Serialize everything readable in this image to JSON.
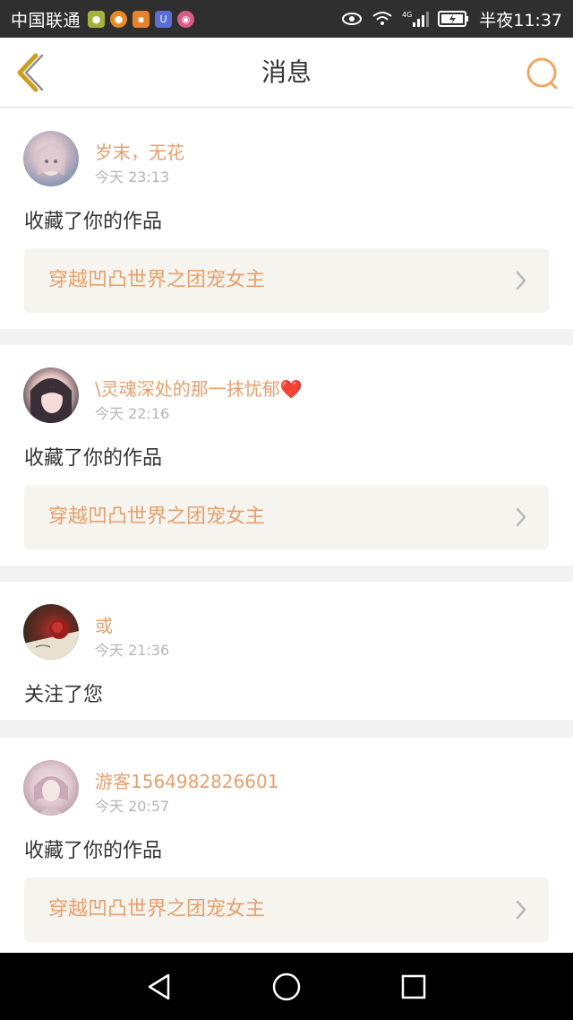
{
  "status_bar": {
    "carrier": "中国联通",
    "time": "半夜11:37",
    "network": "4G",
    "app_icons": [
      "wechat-icon",
      "weibo-icon",
      "taobao-icon",
      "uc-icon",
      "browser-icon"
    ]
  },
  "header": {
    "title": "消息",
    "back_icon": "chevron-left-icon",
    "search_icon": "search-icon"
  },
  "messages": [
    {
      "username": "岁末，无花",
      "time": "今天 23:13",
      "action": "收藏了你的作品",
      "work_title": "穿越凹凸世界之团宠女主"
    },
    {
      "username": "\\灵魂深处的那一抹忧郁❤️",
      "time": "今天 22:16",
      "action": "收藏了你的作品",
      "work_title": "穿越凹凸世界之团宠女主"
    },
    {
      "username": "或",
      "time": "今天 21:36",
      "action": "关注了您"
    },
    {
      "username": "游客1564982826601",
      "time": "今天 20:57",
      "action": "收藏了你的作品",
      "work_title": "穿越凹凸世界之团宠女主"
    }
  ],
  "nav_bar": {
    "buttons": [
      "back-triangle-icon",
      "home-circle-icon",
      "recents-square-icon"
    ]
  },
  "colors": {
    "accent": "#e6a06c",
    "back_icon": "#c9a020",
    "card_bg": "#ffffff",
    "page_bg": "#f3f3f3",
    "link_bg": "#f5f4ef",
    "status_bar": "#2f2f2f",
    "nav_bar": "#000000"
  }
}
